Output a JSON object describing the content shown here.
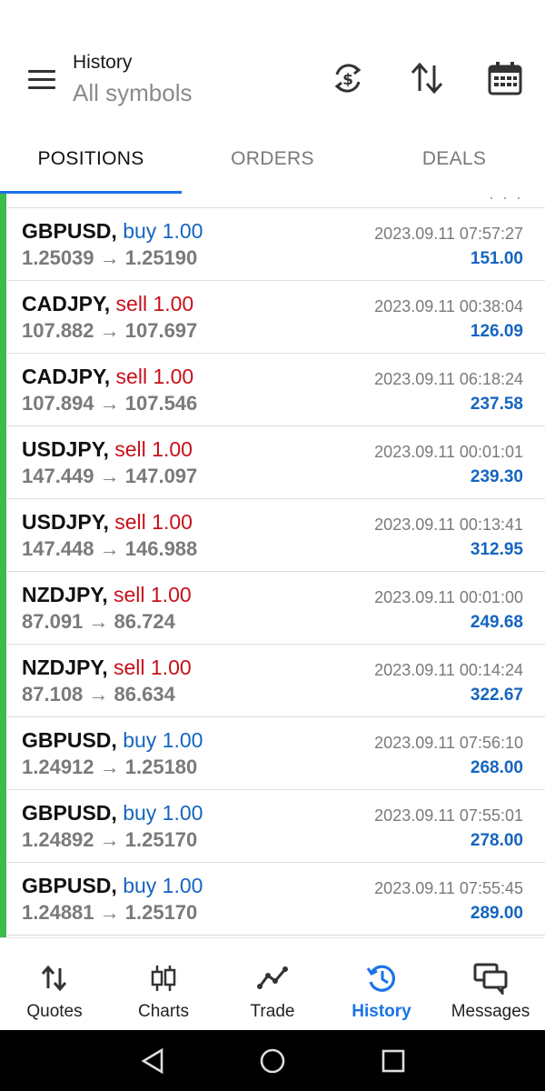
{
  "header": {
    "title": "History",
    "subtitle": "All symbols",
    "icons": [
      "menu-icon",
      "currency-exchange-icon",
      "sort-icon",
      "calendar-icon"
    ]
  },
  "tabs": [
    {
      "label": "POSITIONS",
      "active": true
    },
    {
      "label": "ORDERS",
      "active": false
    },
    {
      "label": "DEALS",
      "active": false
    }
  ],
  "partial_row": {
    "text": "· · ·"
  },
  "positions": [
    {
      "symbol": "GBPUSD,",
      "side": "buy 1.00",
      "side_type": "buy",
      "prices": "1.25039 → 1.25190",
      "time": "2023.09.11 07:57:27",
      "profit": "151.00"
    },
    {
      "symbol": "CADJPY,",
      "side": "sell 1.00",
      "side_type": "sell",
      "prices": "107.882 → 107.697",
      "time": "2023.09.11 00:38:04",
      "profit": "126.09"
    },
    {
      "symbol": "CADJPY,",
      "side": "sell 1.00",
      "side_type": "sell",
      "prices": "107.894 → 107.546",
      "time": "2023.09.11 06:18:24",
      "profit": "237.58"
    },
    {
      "symbol": "USDJPY,",
      "side": "sell 1.00",
      "side_type": "sell",
      "prices": "147.449 → 147.097",
      "time": "2023.09.11 00:01:01",
      "profit": "239.30"
    },
    {
      "symbol": "USDJPY,",
      "side": "sell 1.00",
      "side_type": "sell",
      "prices": "147.448 → 146.988",
      "time": "2023.09.11 00:13:41",
      "profit": "312.95"
    },
    {
      "symbol": "NZDJPY,",
      "side": "sell 1.00",
      "side_type": "sell",
      "prices": "87.091 → 86.724",
      "time": "2023.09.11 00:01:00",
      "profit": "249.68"
    },
    {
      "symbol": "NZDJPY,",
      "side": "sell 1.00",
      "side_type": "sell",
      "prices": "87.108 → 86.634",
      "time": "2023.09.11 00:14:24",
      "profit": "322.67"
    },
    {
      "symbol": "GBPUSD,",
      "side": "buy 1.00",
      "side_type": "buy",
      "prices": "1.24912 → 1.25180",
      "time": "2023.09.11 07:56:10",
      "profit": "268.00"
    },
    {
      "symbol": "GBPUSD,",
      "side": "buy 1.00",
      "side_type": "buy",
      "prices": "1.24892 → 1.25170",
      "time": "2023.09.11 07:55:01",
      "profit": "278.00"
    },
    {
      "symbol": "GBPUSD,",
      "side": "buy 1.00",
      "side_type": "buy",
      "prices": "1.24881 → 1.25170",
      "time": "2023.09.11 07:55:45",
      "profit": "289.00"
    }
  ],
  "bottom_nav": [
    {
      "label": "Quotes",
      "icon": "quotes-arrows-icon",
      "active": false
    },
    {
      "label": "Charts",
      "icon": "candlestick-chart-icon",
      "active": false
    },
    {
      "label": "Trade",
      "icon": "trade-line-icon",
      "active": false
    },
    {
      "label": "History",
      "icon": "history-clock-icon",
      "active": true
    },
    {
      "label": "Messages",
      "icon": "messages-icon",
      "active": false
    }
  ],
  "system_nav": [
    "back-icon",
    "home-icon",
    "recents-icon"
  ],
  "colors": {
    "accent": "#1a73e8",
    "buy": "#1565c0",
    "sell": "#c8101a",
    "profit": "#1565c0",
    "position_bar": "#3dbb4b"
  }
}
